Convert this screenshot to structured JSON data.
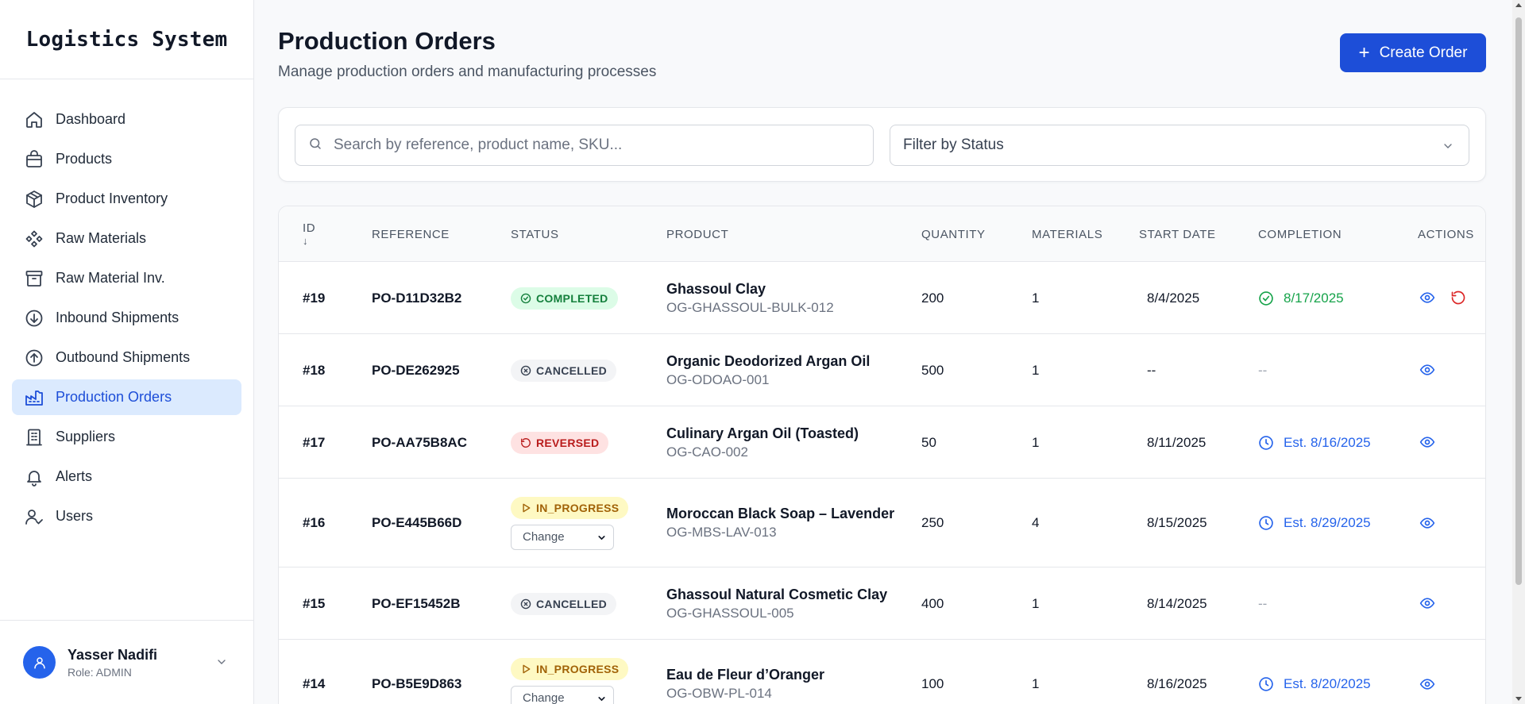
{
  "app": {
    "title": "Logistics System"
  },
  "sidebar": {
    "items": [
      {
        "label": "Dashboard",
        "icon": "home-icon"
      },
      {
        "label": "Products",
        "icon": "shopping-bag-icon"
      },
      {
        "label": "Product Inventory",
        "icon": "package-icon"
      },
      {
        "label": "Raw Materials",
        "icon": "components-icon"
      },
      {
        "label": "Raw Material Inv.",
        "icon": "archive-icon"
      },
      {
        "label": "Inbound Shipments",
        "icon": "arrow-down-circle-icon"
      },
      {
        "label": "Outbound Shipments",
        "icon": "arrow-up-circle-icon"
      },
      {
        "label": "Production Orders",
        "icon": "factory-icon",
        "active": true
      },
      {
        "label": "Suppliers",
        "icon": "building-icon"
      },
      {
        "label": "Alerts",
        "icon": "bell-icon"
      },
      {
        "label": "Users",
        "icon": "user-check-icon"
      }
    ],
    "user": {
      "name": "Yasser Nadifi",
      "role": "Role: ADMIN"
    }
  },
  "header": {
    "title": "Production Orders",
    "subtitle": "Manage production orders and manufacturing processes",
    "create_label": "Create Order"
  },
  "filters": {
    "search_placeholder": "Search by reference, product name, SKU...",
    "status_placeholder": "Filter by Status"
  },
  "table": {
    "headers": {
      "id": "ID",
      "id_sort": "↓",
      "reference": "REFERENCE",
      "status": "STATUS",
      "product": "PRODUCT",
      "quantity": "QUANTITY",
      "materials": "MATERIALS",
      "start_date": "START DATE",
      "completion": "COMPLETION",
      "actions": "ACTIONS"
    },
    "change_label": "Change",
    "rows": [
      {
        "id": "#19",
        "reference": "PO-D11D32B2",
        "status": "COMPLETED",
        "product": "Ghassoul Clay",
        "sku": "OG-GHASSOUL-BULK-012",
        "quantity": "200",
        "materials": "1",
        "start_date": "8/4/2025",
        "completion": "8/17/2025"
      },
      {
        "id": "#18",
        "reference": "PO-DE262925",
        "status": "CANCELLED",
        "product": "Organic Deodorized Argan Oil",
        "sku": "OG-ODOAO-001",
        "quantity": "500",
        "materials": "1",
        "start_date": "--",
        "completion": "--"
      },
      {
        "id": "#17",
        "reference": "PO-AA75B8AC",
        "status": "REVERSED",
        "product": "Culinary Argan Oil (Toasted)",
        "sku": "OG-CAO-002",
        "quantity": "50",
        "materials": "1",
        "start_date": "8/11/2025",
        "completion": "Est. 8/16/2025"
      },
      {
        "id": "#16",
        "reference": "PO-E445B66D",
        "status": "IN_PROGRESS",
        "product": "Moroccan Black Soap – Lavender",
        "sku": "OG-MBS-LAV-013",
        "quantity": "250",
        "materials": "4",
        "start_date": "8/15/2025",
        "completion": "Est. 8/29/2025"
      },
      {
        "id": "#15",
        "reference": "PO-EF15452B",
        "status": "CANCELLED",
        "product": "Ghassoul Natural Cosmetic Clay",
        "sku": "OG-GHASSOUL-005",
        "quantity": "400",
        "materials": "1",
        "start_date": "8/14/2025",
        "completion": "--"
      },
      {
        "id": "#14",
        "reference": "PO-B5E9D863",
        "status": "IN_PROGRESS",
        "product": "Eau de Fleur d’Oranger",
        "sku": "OG-OBW-PL-014",
        "quantity": "100",
        "materials": "1",
        "start_date": "8/16/2025",
        "completion": "Est. 8/20/2025"
      }
    ]
  },
  "colors": {
    "primary": "#1d4ed8",
    "active_nav_bg": "#dbeafe",
    "completed": "#16a34a",
    "reversed": "#dc2626",
    "in_progress": "#a16207"
  }
}
